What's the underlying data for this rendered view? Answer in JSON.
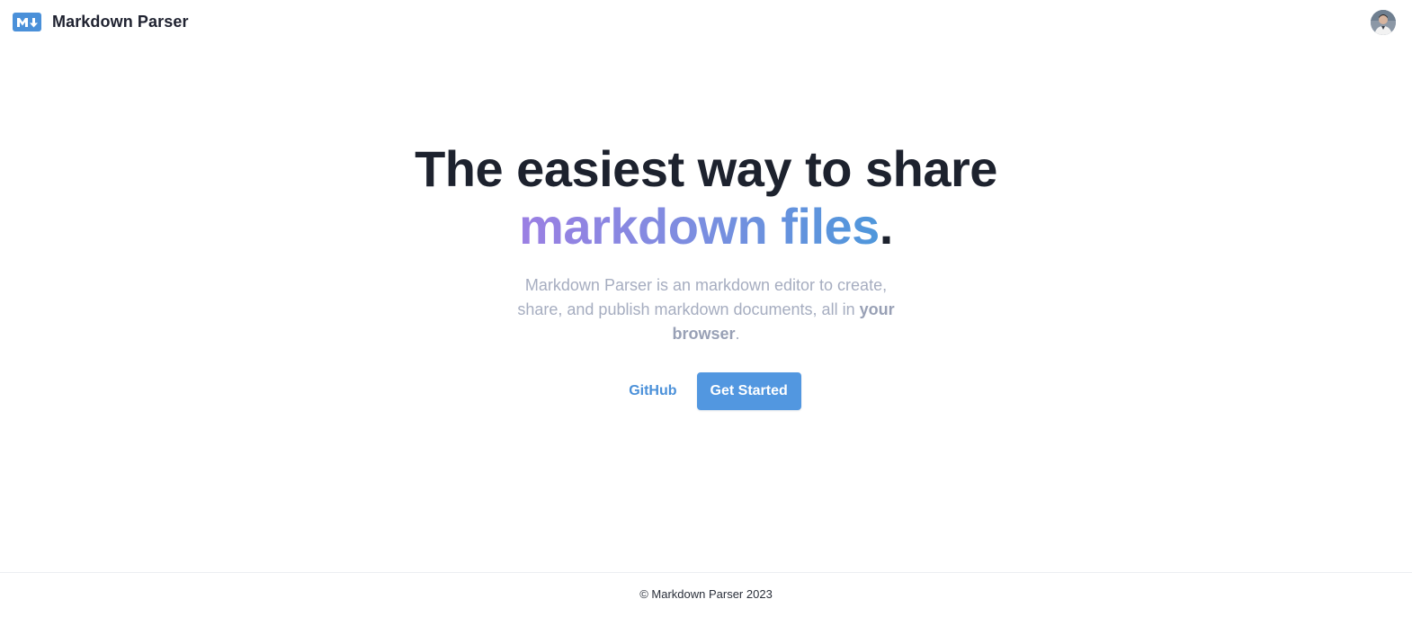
{
  "header": {
    "logo_icon": "markdown-mark-icon",
    "brand": "Markdown Parser",
    "avatar_icon": "user-avatar"
  },
  "hero": {
    "title_line1": "The easiest way to share",
    "title_highlight": "markdown files",
    "title_end": ".",
    "desc_text": "Markdown Parser is an markdown editor to create, share, and publish markdown documents, all in ",
    "desc_bold": "your browser",
    "desc_end": "."
  },
  "actions": {
    "github_label": "GitHub",
    "get_started_label": "Get Started"
  },
  "footer": {
    "copyright": "© Markdown Parser 2023"
  },
  "colors": {
    "accent": "#4a90d9",
    "button": "#5297e0",
    "gradient_start": "#9b7fe3",
    "gradient_end": "#4e97db",
    "title": "#1d222e",
    "muted_text": "#a6adc0"
  }
}
